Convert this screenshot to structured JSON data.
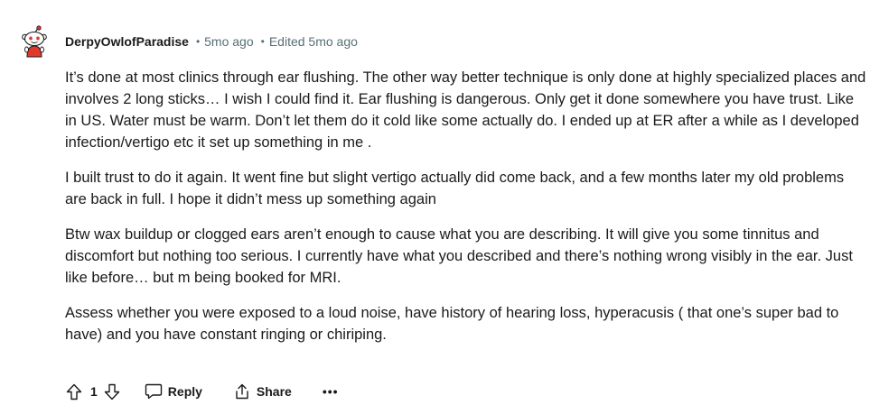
{
  "comment": {
    "author": "DerpyOwlofParadise",
    "separator": "•",
    "timestamp": "5mo ago",
    "edited": "Edited 5mo ago",
    "avatar_icon": "reddit-snoo-avatar-icon",
    "paragraphs": [
      "It’s done at most clinics through ear flushing. The other way better technique is only done at highly specialized places and involves 2 long sticks… I wish I could find it. Ear flushing is dangerous. Only get it done somewhere you have trust. Like in US. Water must be warm. Don’t let them do it cold like some actually do. I ended up at ER after a while as I developed infection/vertigo etc it set up something in me .",
      "I built trust to do it again. It went fine but slight vertigo actually did come back, and a few months later my old problems are back in full. I hope it didn’t mess up something again",
      "Btw wax buildup or clogged ears aren’t enough to cause what you are describing. It will give you some tinnitus and discomfort but nothing too serious. I currently have what you described and there’s nothing wrong visibly in the ear. Just like before… but m being booked for MRI.",
      "Assess whether you were exposed to a loud noise, have history of hearing loss, hyperacusis ( that one’s super bad to have) and you have constant ringing or chiriping."
    ]
  },
  "actions": {
    "score": "1",
    "reply_label": "Reply",
    "share_label": "Share",
    "more_label": "•••",
    "icons": [
      "upvote-icon",
      "downvote-icon",
      "comment-icon",
      "share-icon",
      "more-icon"
    ]
  },
  "colors": {
    "text": "#1a1a1b",
    "meta": "#576f76",
    "avatar_red": "#e0392c"
  }
}
